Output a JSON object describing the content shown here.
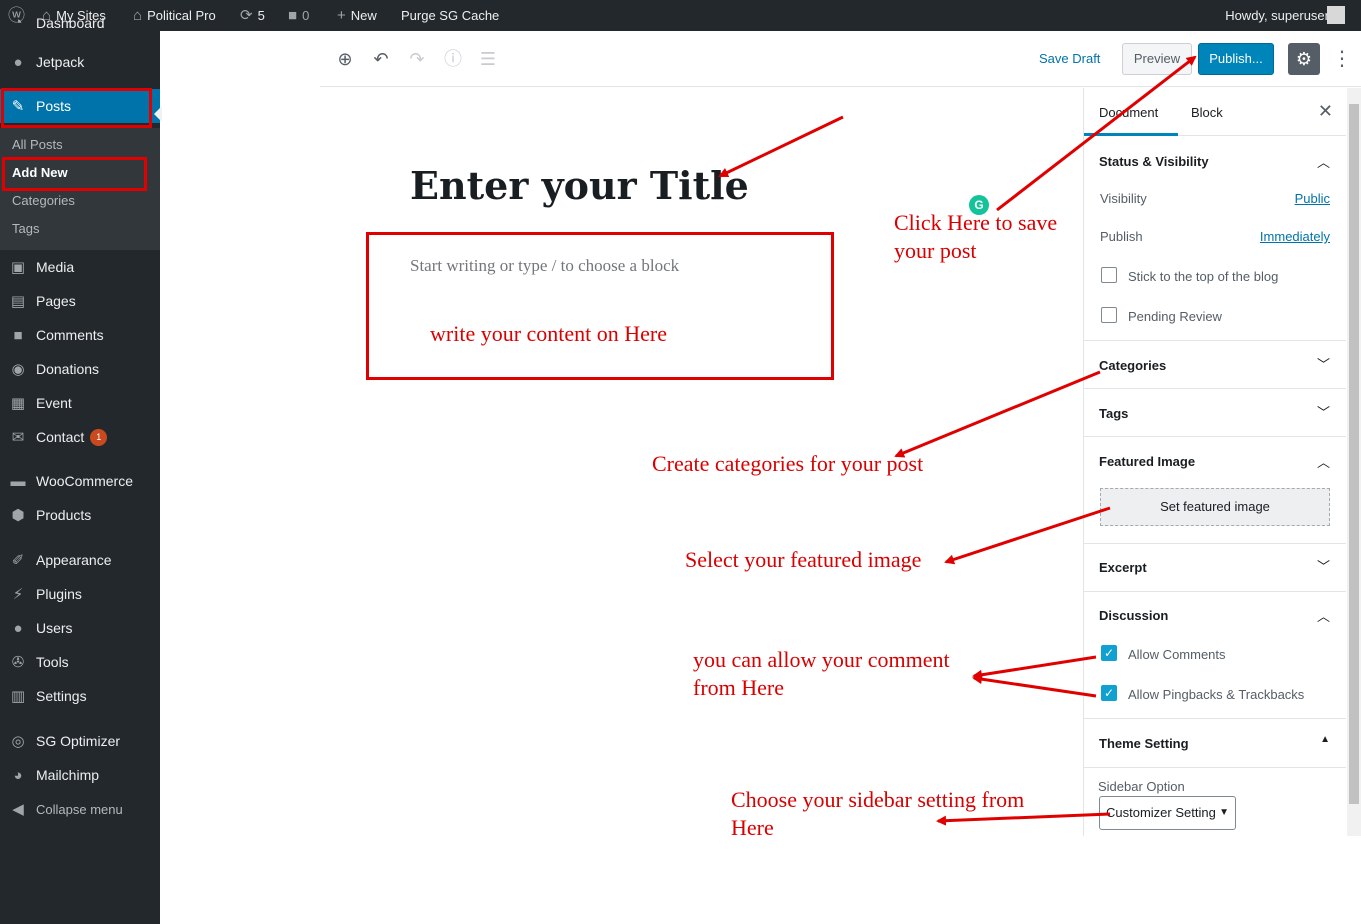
{
  "admin_bar": {
    "my_sites": "My Sites",
    "site_name": "Political Pro",
    "updates_count": "5",
    "comments_count": "0",
    "new_label": "New",
    "purge_label": "Purge SG Cache",
    "howdy": "Howdy, superuser"
  },
  "sidebar": {
    "dashboard": "Dashboard",
    "jetpack": "Jetpack",
    "posts": "Posts",
    "posts_submenu": [
      "All Posts",
      "Add New",
      "Categories",
      "Tags"
    ],
    "media": "Media",
    "pages": "Pages",
    "comments": "Comments",
    "donations": "Donations",
    "event": "Event",
    "contact": "Contact",
    "contact_badge": "1",
    "woocommerce": "WooCommerce",
    "products": "Products",
    "appearance": "Appearance",
    "plugins": "Plugins",
    "users": "Users",
    "tools": "Tools",
    "settings": "Settings",
    "sg_optimizer": "SG Optimizer",
    "mailchimp": "Mailchimp",
    "collapse": "Collapse menu"
  },
  "toolbar": {
    "save_draft": "Save Draft",
    "preview": "Preview",
    "publish": "Publish...",
    "icons": [
      "add-block-icon",
      "undo-icon",
      "redo-icon",
      "info-icon",
      "outline-icon",
      "gear-icon",
      "more-icon"
    ]
  },
  "editor": {
    "title": "Enter your Title",
    "placeholder": "Start writing or type / to choose a block"
  },
  "settings_panel": {
    "tabs": [
      "Document",
      "Block"
    ],
    "status_visibility": "Status & Visibility",
    "visibility_label": "Visibility",
    "visibility_value": "Public",
    "publish_label": "Publish",
    "publish_value": "Immediately",
    "stick_label": "Stick to the top of the blog",
    "pending_label": "Pending Review",
    "categories": "Categories",
    "tags": "Tags",
    "featured_image": "Featured Image",
    "set_featured": "Set featured image",
    "excerpt": "Excerpt",
    "discussion": "Discussion",
    "allow_comments": "Allow Comments",
    "allow_pingbacks": "Allow Pingbacks & Trackbacks",
    "theme_setting": "Theme Setting",
    "sidebar_option": "Sidebar Option",
    "sidebar_select": "Customizer Setting"
  },
  "annotations": {
    "content": "write your content on Here",
    "publish_1": "Click Here to save",
    "publish_2": "your post",
    "categories": "Create categories for your post",
    "featured": "Select your featured image",
    "comment_1": "you can allow your comment",
    "comment_2": "from Here",
    "sidebar_1": "Choose your sidebar setting from",
    "sidebar_2": "Here"
  },
  "colors": {
    "admin_dark": "#23282d",
    "wp_blue": "#0073aa",
    "publish_blue": "#0085ba",
    "annotation_red": "#d80000"
  }
}
